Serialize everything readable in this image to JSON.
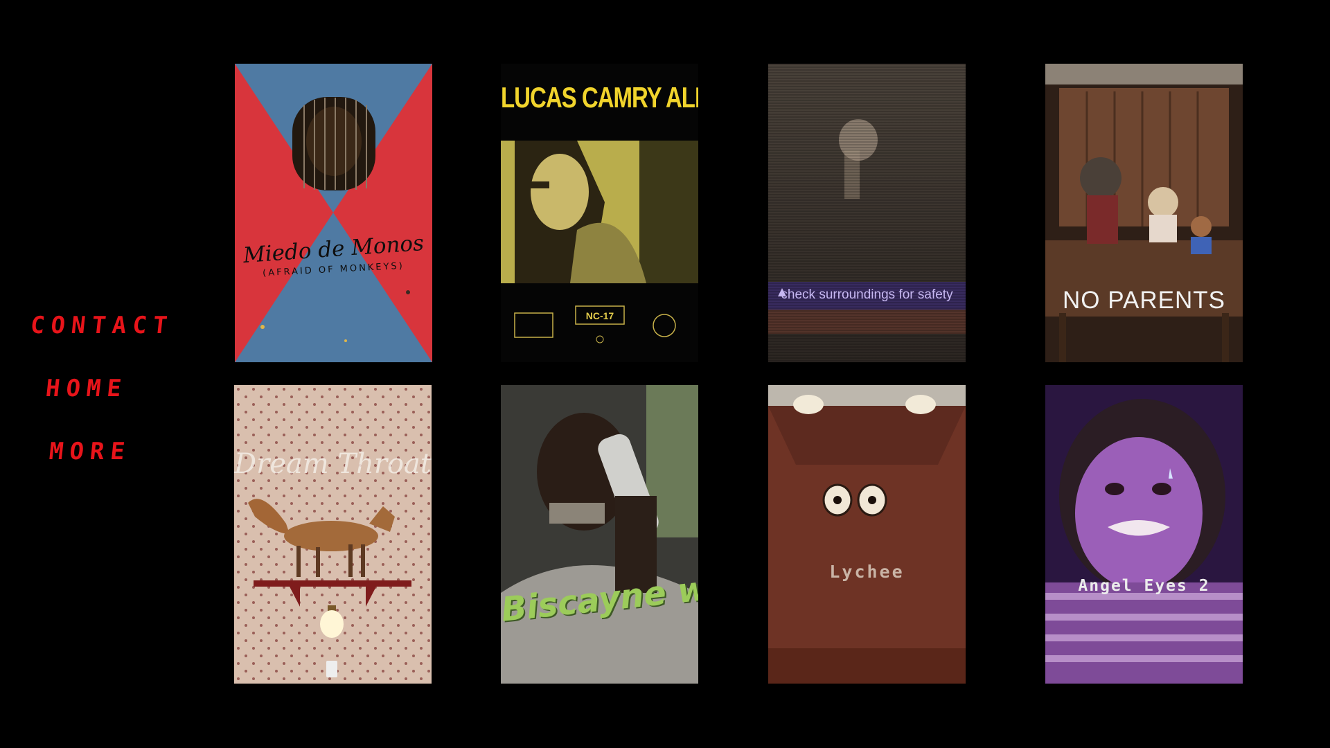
{
  "nav": {
    "items": [
      {
        "label": "CONTACT"
      },
      {
        "label": "HOME"
      },
      {
        "label": "MORE"
      }
    ]
  },
  "colors": {
    "background": "#000000",
    "nav_text": "#e8141a"
  },
  "posters": [
    {
      "title": "Miedo de Monos",
      "subtitle": "(AFRAID OF MONKEYS)"
    },
    {
      "title": "LUCAS CAMRY ALEX",
      "rating": "NC-17"
    },
    {
      "caption": "check surroundings for safety"
    },
    {
      "title": "NO PARENTS"
    },
    {
      "title": "Dream Throat"
    },
    {
      "title": "Biscayne world!"
    },
    {
      "title": "Lychee"
    },
    {
      "title": "Angel Eyes 2"
    }
  ]
}
